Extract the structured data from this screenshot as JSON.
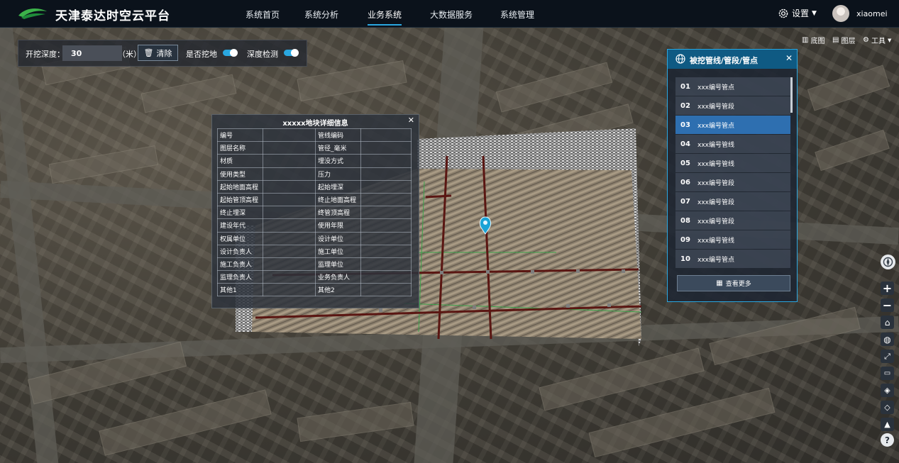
{
  "header": {
    "app_title": "天津泰达时空云平台",
    "nav": [
      "系统首页",
      "系统分析",
      "业务系统",
      "大数据服务",
      "系统管理"
    ],
    "active_nav": "业务系统",
    "settings_label": "设置",
    "username": "xiaomei"
  },
  "toolbar": {
    "depth_label": "开挖深度：",
    "depth_value": "30",
    "depth_unit": "（米）",
    "clear_label": "清除",
    "toggle1_label": "是否挖地",
    "toggle1_on": true,
    "toggle2_label": "深度检测",
    "toggle2_on": true
  },
  "map_tools": {
    "basemap_label": "底图",
    "layers_label": "图层",
    "tools_label": "工具"
  },
  "info_panel": {
    "title": "xxxxx地块详细信息",
    "rows": [
      [
        "编号",
        "",
        "管线编码",
        ""
      ],
      [
        "图层名称",
        "",
        "管径_毫米",
        ""
      ],
      [
        "材质",
        "",
        "埋没方式",
        ""
      ],
      [
        "使用类型",
        "",
        "压力",
        ""
      ],
      [
        "起始地面高程",
        "",
        "起始埋深",
        ""
      ],
      [
        "起始管顶高程",
        "",
        "终止地面高程",
        ""
      ],
      [
        "终止埋深",
        "",
        "终管顶高程",
        ""
      ],
      [
        "建设年代",
        "",
        "使用年限",
        ""
      ],
      [
        "权属单位",
        "",
        "设计单位",
        ""
      ],
      [
        "设计负责人",
        "",
        "施工单位",
        ""
      ],
      [
        "施工负责人",
        "",
        "监理单位",
        ""
      ],
      [
        "监理负责人",
        "",
        "业务负责人",
        ""
      ],
      [
        "其他1",
        "",
        "其他2",
        ""
      ]
    ]
  },
  "pipe_panel": {
    "title": "被挖管线/管段/管点",
    "items": [
      {
        "num": "01",
        "label": "xxx编号管点"
      },
      {
        "num": "02",
        "label": "xxx编号管段"
      },
      {
        "num": "03",
        "label": "xxx编号管点"
      },
      {
        "num": "04",
        "label": "xxx编号管线"
      },
      {
        "num": "05",
        "label": "xxx编号管线"
      },
      {
        "num": "06",
        "label": "xxx编号管段"
      },
      {
        "num": "07",
        "label": "xxx编号管段"
      },
      {
        "num": "08",
        "label": "xxx编号管段"
      },
      {
        "num": "09",
        "label": "xxx编号管线"
      },
      {
        "num": "10",
        "label": "xxx编号管点"
      }
    ],
    "selected_index": 2,
    "more_label": "查看更多"
  },
  "controls": [
    "compass-icon",
    "zoom-in-icon",
    "zoom-out-icon",
    "home-icon",
    "globe-icon",
    "fullscreen-icon",
    "vr-icon",
    "layers-up-icon",
    "layers-down-icon",
    "terrain-icon",
    "help-icon"
  ],
  "colors": {
    "accent": "#2aa7e0",
    "header_bg": "#0b121b",
    "selected_row": "#2e6fb0",
    "pipe": "#5a1612"
  }
}
